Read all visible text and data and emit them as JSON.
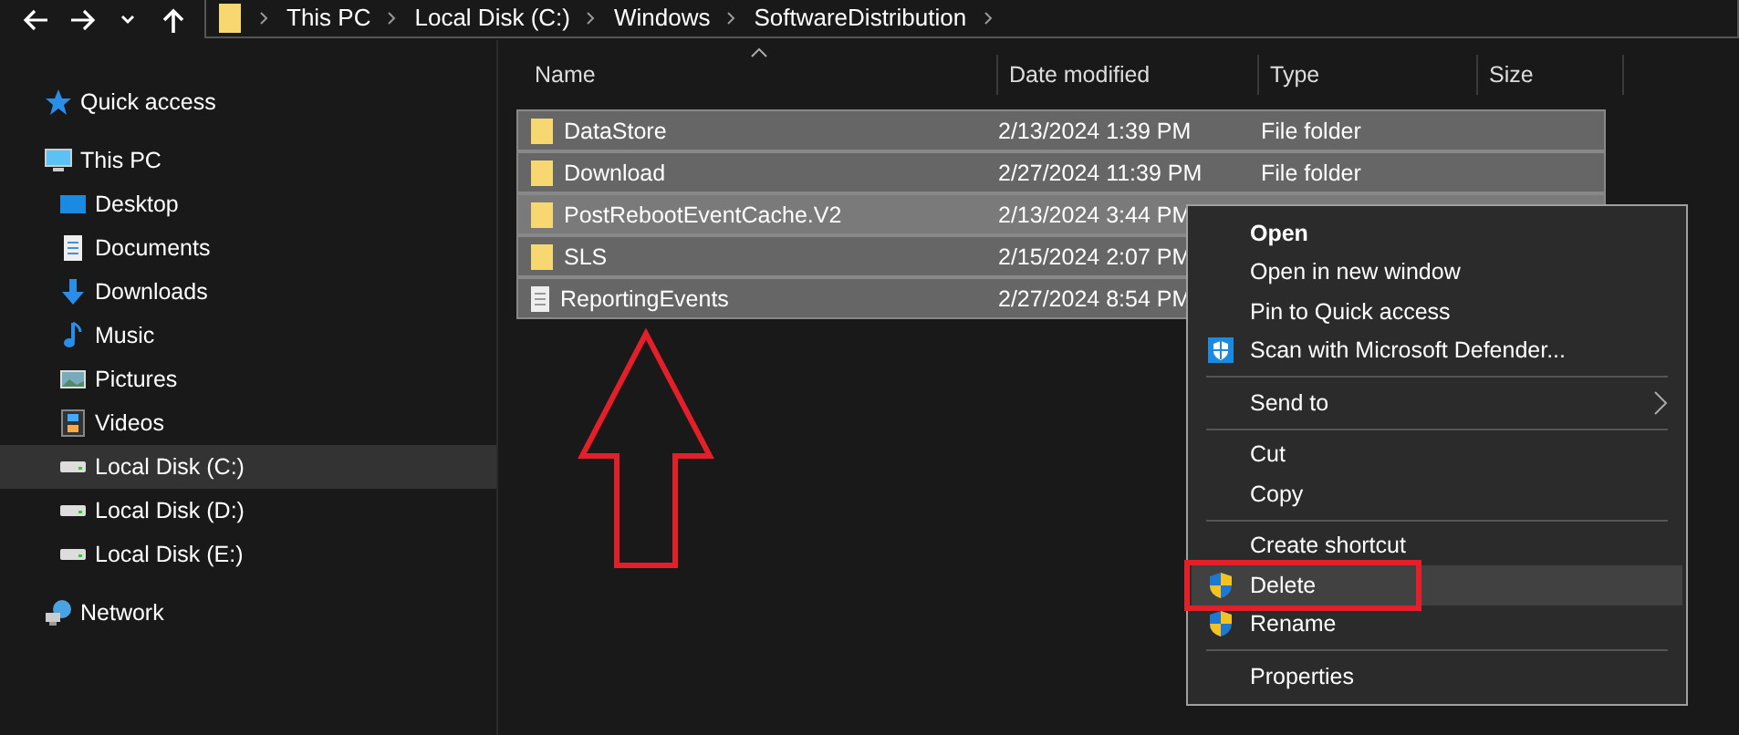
{
  "breadcrumb": [
    "This PC",
    "Local Disk (C:)",
    "Windows",
    "SoftwareDistribution"
  ],
  "sidebar": {
    "items": [
      {
        "label": "Quick access",
        "kind": "star",
        "selected": false
      },
      {
        "label": "This PC",
        "kind": "pc",
        "selected": false,
        "children": [
          {
            "label": "Desktop",
            "kind": "desktop",
            "selected": false
          },
          {
            "label": "Documents",
            "kind": "document",
            "selected": false
          },
          {
            "label": "Downloads",
            "kind": "download",
            "selected": false
          },
          {
            "label": "Music",
            "kind": "music",
            "selected": false
          },
          {
            "label": "Pictures",
            "kind": "pictures",
            "selected": false
          },
          {
            "label": "Videos",
            "kind": "videos",
            "selected": false
          },
          {
            "label": "Local Disk (C:)",
            "kind": "drive",
            "selected": true
          },
          {
            "label": "Local Disk (D:)",
            "kind": "drive",
            "selected": false
          },
          {
            "label": "Local Disk (E:)",
            "kind": "drive",
            "selected": false
          }
        ]
      },
      {
        "label": "Network",
        "kind": "network",
        "selected": false
      }
    ]
  },
  "table": {
    "columns": [
      "Name",
      "Date modified",
      "Type",
      "Size"
    ],
    "rows": [
      {
        "kind": "folder",
        "name": "DataStore",
        "date": "2/13/2024 1:39 PM",
        "type": "File folder",
        "selected": true,
        "hovered": false
      },
      {
        "kind": "folder",
        "name": "Download",
        "date": "2/27/2024 11:39 PM",
        "type": "File folder",
        "selected": true,
        "hovered": false
      },
      {
        "kind": "folder",
        "name": "PostRebootEventCache.V2",
        "date": "2/13/2024 3:44 PM",
        "selected": true,
        "hovered": true
      },
      {
        "kind": "folder",
        "name": "SLS",
        "date": "2/15/2024 2:07 PM",
        "selected": true,
        "hovered": false
      },
      {
        "kind": "file",
        "name": "ReportingEvents",
        "date": "2/27/2024 8:54 PM",
        "selected": true,
        "hovered": false
      }
    ]
  },
  "context_menu": {
    "items": [
      {
        "kind": "item",
        "label": "Open",
        "bold": true
      },
      {
        "kind": "item",
        "label": "Open in new window"
      },
      {
        "kind": "item",
        "label": "Pin to Quick access"
      },
      {
        "kind": "defender",
        "label": "Scan with Microsoft Defender..."
      },
      {
        "kind": "separator"
      },
      {
        "kind": "item",
        "label": "Send to",
        "submenu": true
      },
      {
        "kind": "separator"
      },
      {
        "kind": "item",
        "label": "Cut"
      },
      {
        "kind": "item",
        "label": "Copy"
      },
      {
        "kind": "separator"
      },
      {
        "kind": "item",
        "label": "Create shortcut"
      },
      {
        "kind": "elevated",
        "label": "Delete",
        "selected": true,
        "outlined": true
      },
      {
        "kind": "elevated",
        "label": "Rename"
      },
      {
        "kind": "separator"
      },
      {
        "kind": "item",
        "label": "Properties"
      }
    ]
  }
}
